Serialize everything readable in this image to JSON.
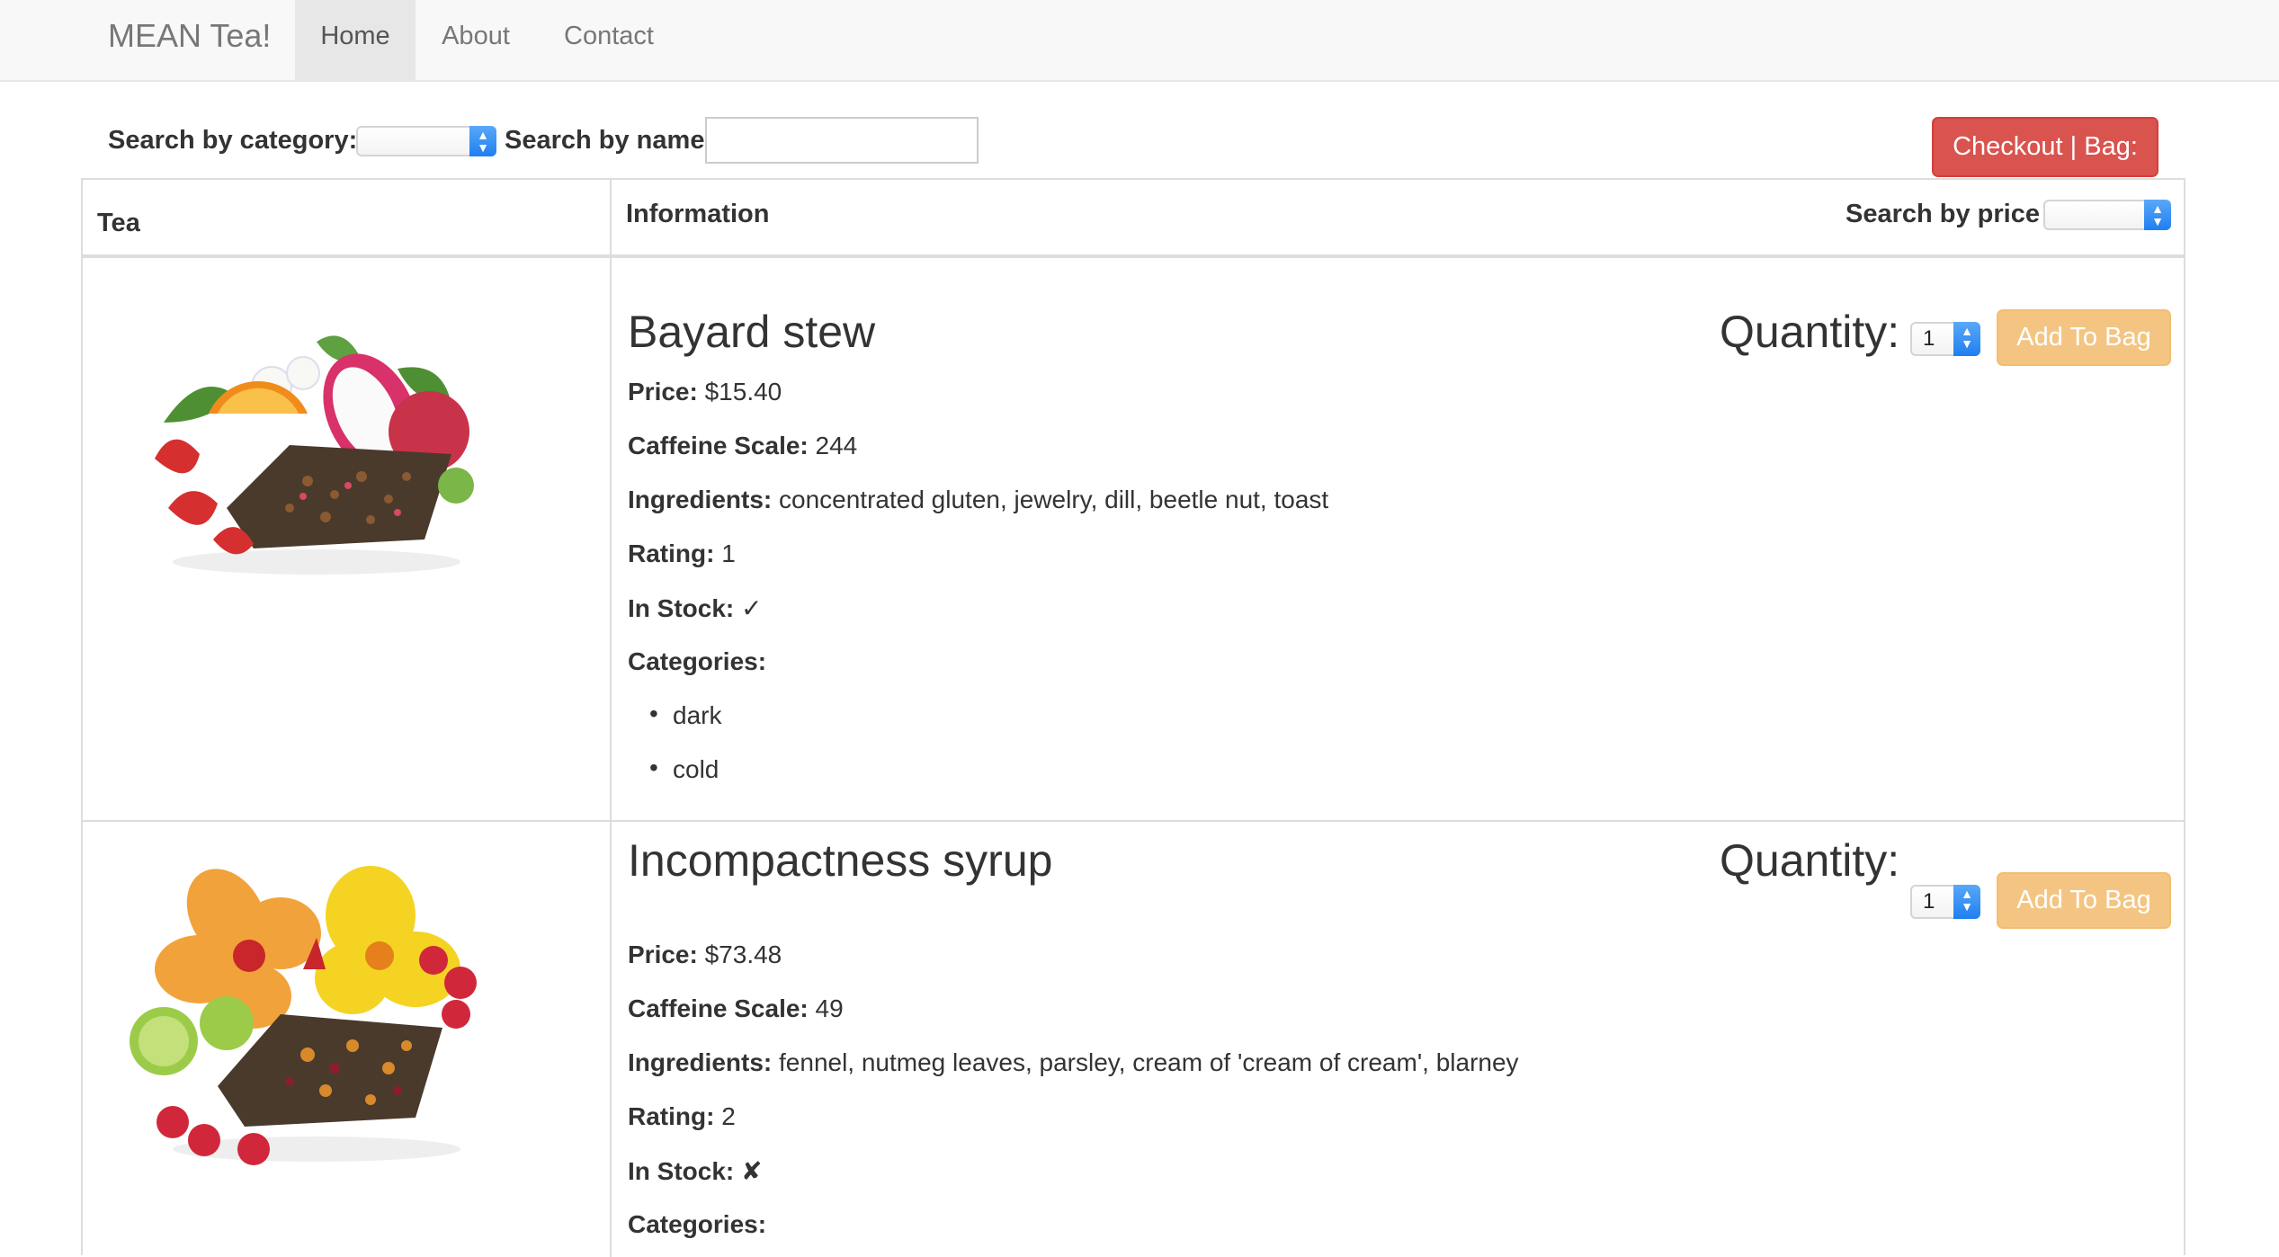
{
  "navbar": {
    "brand": "MEAN Tea!",
    "items": [
      {
        "label": "Home",
        "active": true
      },
      {
        "label": "About",
        "active": false
      },
      {
        "label": "Contact",
        "active": false
      }
    ]
  },
  "search": {
    "category_label": "Search by category:",
    "category_value": "",
    "name_label": "Search by name",
    "name_value": "",
    "checkout_label": "Checkout | Bag:"
  },
  "table": {
    "col_tea": "Tea",
    "col_information": "Information",
    "price_search_label": "Search by price",
    "price_search_value": ""
  },
  "labels": {
    "quantity": "Quantity:",
    "add_to_bag": "Add To Bag",
    "price": "Price:",
    "caffeine": "Caffeine Scale:",
    "ingredients": "Ingredients:",
    "rating": "Rating:",
    "in_stock": "In Stock:",
    "categories": "Categories:"
  },
  "products": [
    {
      "name": "Bayard stew",
      "price": "$15.40",
      "caffeine": "244",
      "ingredients": "concentrated gluten, jewelry, dill, beetle nut, toast",
      "rating": "1",
      "in_stock": "✓",
      "categories": [
        "dark",
        "cold"
      ],
      "quantity": "1",
      "image_icon": "fruit-tea-image"
    },
    {
      "name": "Incompactness syrup",
      "price": "$73.48",
      "caffeine": "49",
      "ingredients": "fennel, nutmeg leaves, parsley, cream of 'cream of cream', blarney",
      "rating": "2",
      "in_stock": "✘",
      "categories": [],
      "quantity": "1",
      "image_icon": "hibiscus-tea-image"
    }
  ],
  "colors": {
    "danger": "#d9534f",
    "warning": "#f0ad4e",
    "navbar_bg": "#f8f8f8",
    "select_arrow": "#1f7ff0"
  }
}
